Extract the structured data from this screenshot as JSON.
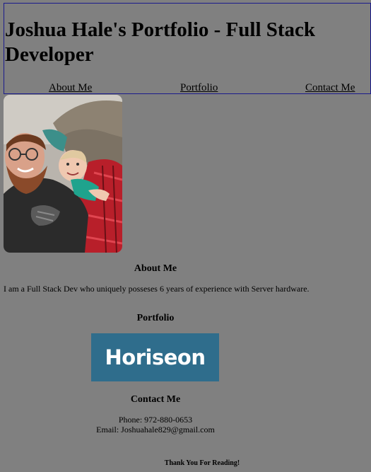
{
  "header": {
    "title": "Joshua Hale's Portfolio - Full Stack Developer",
    "nav": [
      {
        "label": "About Me"
      },
      {
        "label": "Portfolio"
      },
      {
        "label": "Contact Me"
      }
    ]
  },
  "about": {
    "heading": "About Me",
    "text": "I am a Full Stack Dev who uniquely posseses 6 years of experience with Server hardware."
  },
  "portfolio": {
    "heading": "Portfolio",
    "logo_text": "Horiseon"
  },
  "contact": {
    "heading": "Contact Me",
    "phone": "Phone: 972-880-0653",
    "email": "Email: Joshuahale829@gmail.com"
  },
  "footer": {
    "text": "Thank You For Reading!"
  }
}
